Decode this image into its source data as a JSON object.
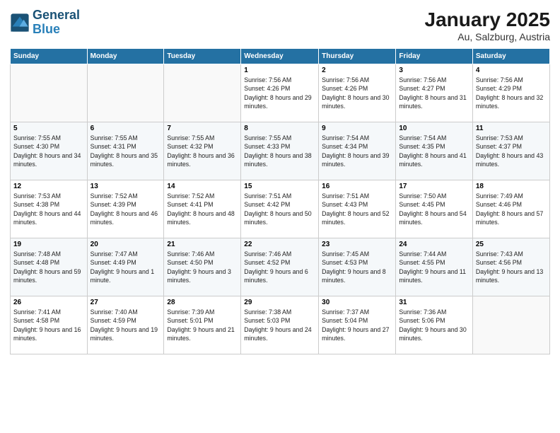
{
  "logo": {
    "line1": "General",
    "line2": "Blue"
  },
  "title": "January 2025",
  "subtitle": "Au, Salzburg, Austria",
  "days_of_week": [
    "Sunday",
    "Monday",
    "Tuesday",
    "Wednesday",
    "Thursday",
    "Friday",
    "Saturday"
  ],
  "weeks": [
    [
      {
        "day": "",
        "sunrise": "",
        "sunset": "",
        "daylight": ""
      },
      {
        "day": "",
        "sunrise": "",
        "sunset": "",
        "daylight": ""
      },
      {
        "day": "",
        "sunrise": "",
        "sunset": "",
        "daylight": ""
      },
      {
        "day": "1",
        "sunrise": "Sunrise: 7:56 AM",
        "sunset": "Sunset: 4:26 PM",
        "daylight": "Daylight: 8 hours and 29 minutes."
      },
      {
        "day": "2",
        "sunrise": "Sunrise: 7:56 AM",
        "sunset": "Sunset: 4:26 PM",
        "daylight": "Daylight: 8 hours and 30 minutes."
      },
      {
        "day": "3",
        "sunrise": "Sunrise: 7:56 AM",
        "sunset": "Sunset: 4:27 PM",
        "daylight": "Daylight: 8 hours and 31 minutes."
      },
      {
        "day": "4",
        "sunrise": "Sunrise: 7:56 AM",
        "sunset": "Sunset: 4:29 PM",
        "daylight": "Daylight: 8 hours and 32 minutes."
      }
    ],
    [
      {
        "day": "5",
        "sunrise": "Sunrise: 7:55 AM",
        "sunset": "Sunset: 4:30 PM",
        "daylight": "Daylight: 8 hours and 34 minutes."
      },
      {
        "day": "6",
        "sunrise": "Sunrise: 7:55 AM",
        "sunset": "Sunset: 4:31 PM",
        "daylight": "Daylight: 8 hours and 35 minutes."
      },
      {
        "day": "7",
        "sunrise": "Sunrise: 7:55 AM",
        "sunset": "Sunset: 4:32 PM",
        "daylight": "Daylight: 8 hours and 36 minutes."
      },
      {
        "day": "8",
        "sunrise": "Sunrise: 7:55 AM",
        "sunset": "Sunset: 4:33 PM",
        "daylight": "Daylight: 8 hours and 38 minutes."
      },
      {
        "day": "9",
        "sunrise": "Sunrise: 7:54 AM",
        "sunset": "Sunset: 4:34 PM",
        "daylight": "Daylight: 8 hours and 39 minutes."
      },
      {
        "day": "10",
        "sunrise": "Sunrise: 7:54 AM",
        "sunset": "Sunset: 4:35 PM",
        "daylight": "Daylight: 8 hours and 41 minutes."
      },
      {
        "day": "11",
        "sunrise": "Sunrise: 7:53 AM",
        "sunset": "Sunset: 4:37 PM",
        "daylight": "Daylight: 8 hours and 43 minutes."
      }
    ],
    [
      {
        "day": "12",
        "sunrise": "Sunrise: 7:53 AM",
        "sunset": "Sunset: 4:38 PM",
        "daylight": "Daylight: 8 hours and 44 minutes."
      },
      {
        "day": "13",
        "sunrise": "Sunrise: 7:52 AM",
        "sunset": "Sunset: 4:39 PM",
        "daylight": "Daylight: 8 hours and 46 minutes."
      },
      {
        "day": "14",
        "sunrise": "Sunrise: 7:52 AM",
        "sunset": "Sunset: 4:41 PM",
        "daylight": "Daylight: 8 hours and 48 minutes."
      },
      {
        "day": "15",
        "sunrise": "Sunrise: 7:51 AM",
        "sunset": "Sunset: 4:42 PM",
        "daylight": "Daylight: 8 hours and 50 minutes."
      },
      {
        "day": "16",
        "sunrise": "Sunrise: 7:51 AM",
        "sunset": "Sunset: 4:43 PM",
        "daylight": "Daylight: 8 hours and 52 minutes."
      },
      {
        "day": "17",
        "sunrise": "Sunrise: 7:50 AM",
        "sunset": "Sunset: 4:45 PM",
        "daylight": "Daylight: 8 hours and 54 minutes."
      },
      {
        "day": "18",
        "sunrise": "Sunrise: 7:49 AM",
        "sunset": "Sunset: 4:46 PM",
        "daylight": "Daylight: 8 hours and 57 minutes."
      }
    ],
    [
      {
        "day": "19",
        "sunrise": "Sunrise: 7:48 AM",
        "sunset": "Sunset: 4:48 PM",
        "daylight": "Daylight: 8 hours and 59 minutes."
      },
      {
        "day": "20",
        "sunrise": "Sunrise: 7:47 AM",
        "sunset": "Sunset: 4:49 PM",
        "daylight": "Daylight: 9 hours and 1 minute."
      },
      {
        "day": "21",
        "sunrise": "Sunrise: 7:46 AM",
        "sunset": "Sunset: 4:50 PM",
        "daylight": "Daylight: 9 hours and 3 minutes."
      },
      {
        "day": "22",
        "sunrise": "Sunrise: 7:46 AM",
        "sunset": "Sunset: 4:52 PM",
        "daylight": "Daylight: 9 hours and 6 minutes."
      },
      {
        "day": "23",
        "sunrise": "Sunrise: 7:45 AM",
        "sunset": "Sunset: 4:53 PM",
        "daylight": "Daylight: 9 hours and 8 minutes."
      },
      {
        "day": "24",
        "sunrise": "Sunrise: 7:44 AM",
        "sunset": "Sunset: 4:55 PM",
        "daylight": "Daylight: 9 hours and 11 minutes."
      },
      {
        "day": "25",
        "sunrise": "Sunrise: 7:43 AM",
        "sunset": "Sunset: 4:56 PM",
        "daylight": "Daylight: 9 hours and 13 minutes."
      }
    ],
    [
      {
        "day": "26",
        "sunrise": "Sunrise: 7:41 AM",
        "sunset": "Sunset: 4:58 PM",
        "daylight": "Daylight: 9 hours and 16 minutes."
      },
      {
        "day": "27",
        "sunrise": "Sunrise: 7:40 AM",
        "sunset": "Sunset: 4:59 PM",
        "daylight": "Daylight: 9 hours and 19 minutes."
      },
      {
        "day": "28",
        "sunrise": "Sunrise: 7:39 AM",
        "sunset": "Sunset: 5:01 PM",
        "daylight": "Daylight: 9 hours and 21 minutes."
      },
      {
        "day": "29",
        "sunrise": "Sunrise: 7:38 AM",
        "sunset": "Sunset: 5:03 PM",
        "daylight": "Daylight: 9 hours and 24 minutes."
      },
      {
        "day": "30",
        "sunrise": "Sunrise: 7:37 AM",
        "sunset": "Sunset: 5:04 PM",
        "daylight": "Daylight: 9 hours and 27 minutes."
      },
      {
        "day": "31",
        "sunrise": "Sunrise: 7:36 AM",
        "sunset": "Sunset: 5:06 PM",
        "daylight": "Daylight: 9 hours and 30 minutes."
      },
      {
        "day": "",
        "sunrise": "",
        "sunset": "",
        "daylight": ""
      }
    ]
  ]
}
